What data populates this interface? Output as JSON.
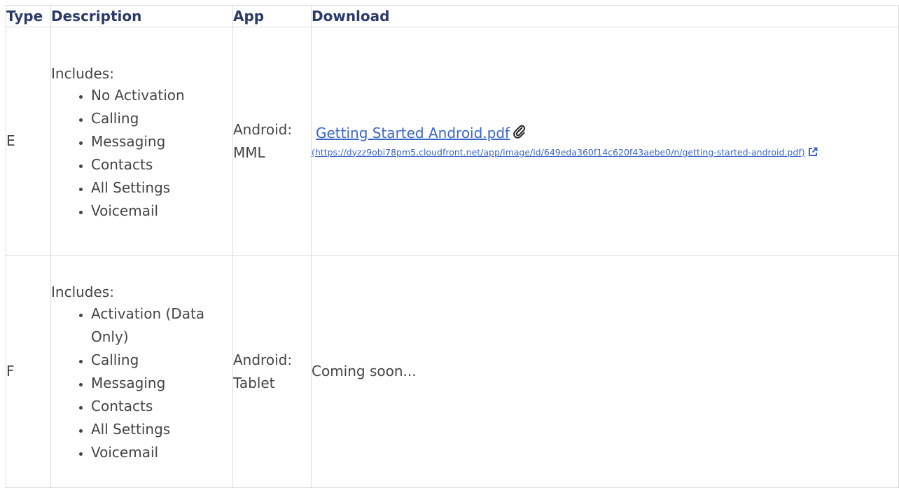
{
  "table": {
    "headers": {
      "type": "Type",
      "description": "Description",
      "app": "App",
      "download": "Download"
    },
    "rows": [
      {
        "type": "E",
        "includes_label": "Includes:",
        "features": [
          "No Activation",
          "Calling",
          "Messaging",
          "Contacts",
          "All Settings",
          "Voicemail"
        ],
        "app_line1": "Android:",
        "app_line2": "MML",
        "download_link_text": "Getting Started Android.pdf",
        "download_url_text": "(https://dyzz9obi78pm5.cloudfront.net/app/image/id/649eda360f14c620f43aebe0/n/getting-started-android.pdf)"
      },
      {
        "type": "F",
        "includes_label": "Includes:",
        "features": [
          "Activation (Data Only)",
          "Calling",
          "Messaging",
          "Contacts",
          "All Settings",
          "Voicemail"
        ],
        "app_line1": "Android:",
        "app_line2": "Tablet",
        "download_text": "Coming soon..."
      }
    ]
  },
  "icons": {
    "attachment": "paperclip-icon",
    "external": "external-link-icon"
  },
  "colors": {
    "header_text": "#2b3a67",
    "link": "#3a66c8",
    "border": "#dcdcdc"
  }
}
